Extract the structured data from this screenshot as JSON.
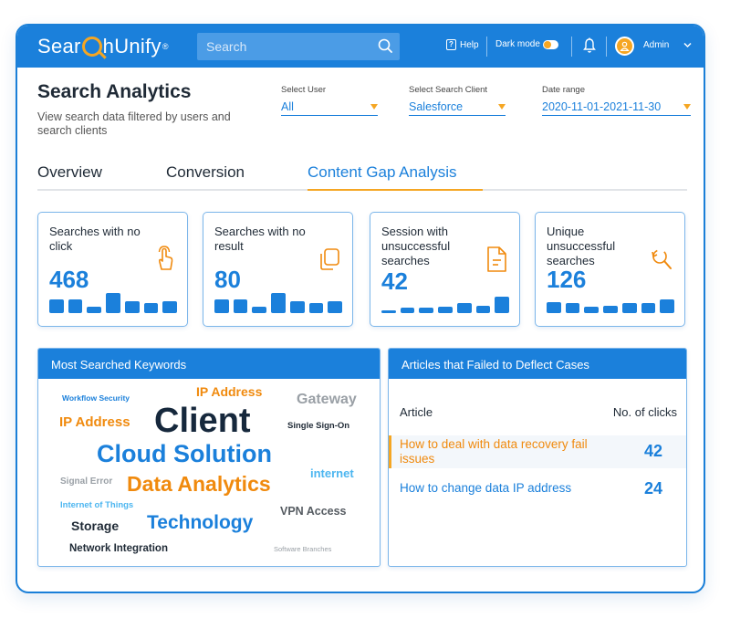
{
  "app": {
    "logo_parts": [
      "Sear",
      "hUnify"
    ],
    "logo_reg": "®"
  },
  "topbar": {
    "search_placeholder": "Search",
    "help_label": "Help",
    "dark_mode_label": "Dark mode",
    "user_name": "Admin"
  },
  "header": {
    "title": "Search Analytics",
    "subtitle": "View search data filtered by users and search clients"
  },
  "filters": [
    {
      "label": "Select User",
      "value": "All"
    },
    {
      "label": "Select Search Client",
      "value": "Salesforce"
    },
    {
      "label": "Date range",
      "value": "2020-11-01-2021-11-30"
    }
  ],
  "tabs": [
    {
      "label": "Overview",
      "active": false
    },
    {
      "label": "Conversion",
      "active": false
    },
    {
      "label": "Content Gap Analysis",
      "active": true
    }
  ],
  "cards": [
    {
      "title": "Searches with no click",
      "value": "468",
      "icon": "click-hand-icon",
      "bars": [
        0.7,
        0.7,
        0.3,
        1.0,
        0.6,
        0.5,
        0.6
      ]
    },
    {
      "title": "Searches with no result",
      "value": "80",
      "icon": "copy-icon",
      "bars": [
        0.7,
        0.7,
        0.3,
        1.0,
        0.6,
        0.5,
        0.6
      ]
    },
    {
      "title": "Session with unsuccessful searches",
      "value": "42",
      "icon": "document-icon",
      "bars": [
        0.15,
        0.25,
        0.25,
        0.3,
        0.5,
        0.35,
        0.8
      ]
    },
    {
      "title": "Unique unsuccessful searches",
      "value": "126",
      "icon": "search-refresh-icon",
      "bars": [
        0.55,
        0.5,
        0.3,
        0.35,
        0.5,
        0.5,
        0.7
      ]
    }
  ],
  "keywords_panel": {
    "title": "Most Searched Keywords",
    "words": [
      {
        "text": "Workflow Security",
        "color": "#1b80db"
      },
      {
        "text": "IP Address",
        "color": "#f08a0e"
      },
      {
        "text": "Gateway",
        "color": "#9aa0a6"
      },
      {
        "text": "IP Address",
        "color": "#f08a0e"
      },
      {
        "text": "Client",
        "color": "#16283c"
      },
      {
        "text": "Single Sign-On",
        "color": "#1f2a36"
      },
      {
        "text": "Cloud Solution",
        "color": "#1b80db"
      },
      {
        "text": "Signal Error",
        "color": "#9aa0a6"
      },
      {
        "text": "Data Analytics",
        "color": "#f08a0e"
      },
      {
        "text": "internet",
        "color": "#4db6f0"
      },
      {
        "text": "Internet of Things",
        "color": "#4db6f0"
      },
      {
        "text": "VPN Access",
        "color": "#555b61"
      },
      {
        "text": "Storage",
        "color": "#1f2a36"
      },
      {
        "text": "Technology",
        "color": "#1b80db"
      },
      {
        "text": "Network Integration",
        "color": "#1f2a36"
      },
      {
        "text": "Software Branches",
        "color": "#9aa0a6"
      }
    ]
  },
  "articles_panel": {
    "title": "Articles that Failed to Deflect Cases",
    "col_article": "Article",
    "col_clicks": "No. of clicks",
    "rows": [
      {
        "title": "How to deal with data recovery fail issues",
        "clicks": "42",
        "highlighted": true
      },
      {
        "title": "How to change data IP address",
        "clicks": "24",
        "highlighted": false
      }
    ]
  },
  "colors": {
    "brand_blue": "#1b80db",
    "accent_orange": "#f5a623"
  }
}
